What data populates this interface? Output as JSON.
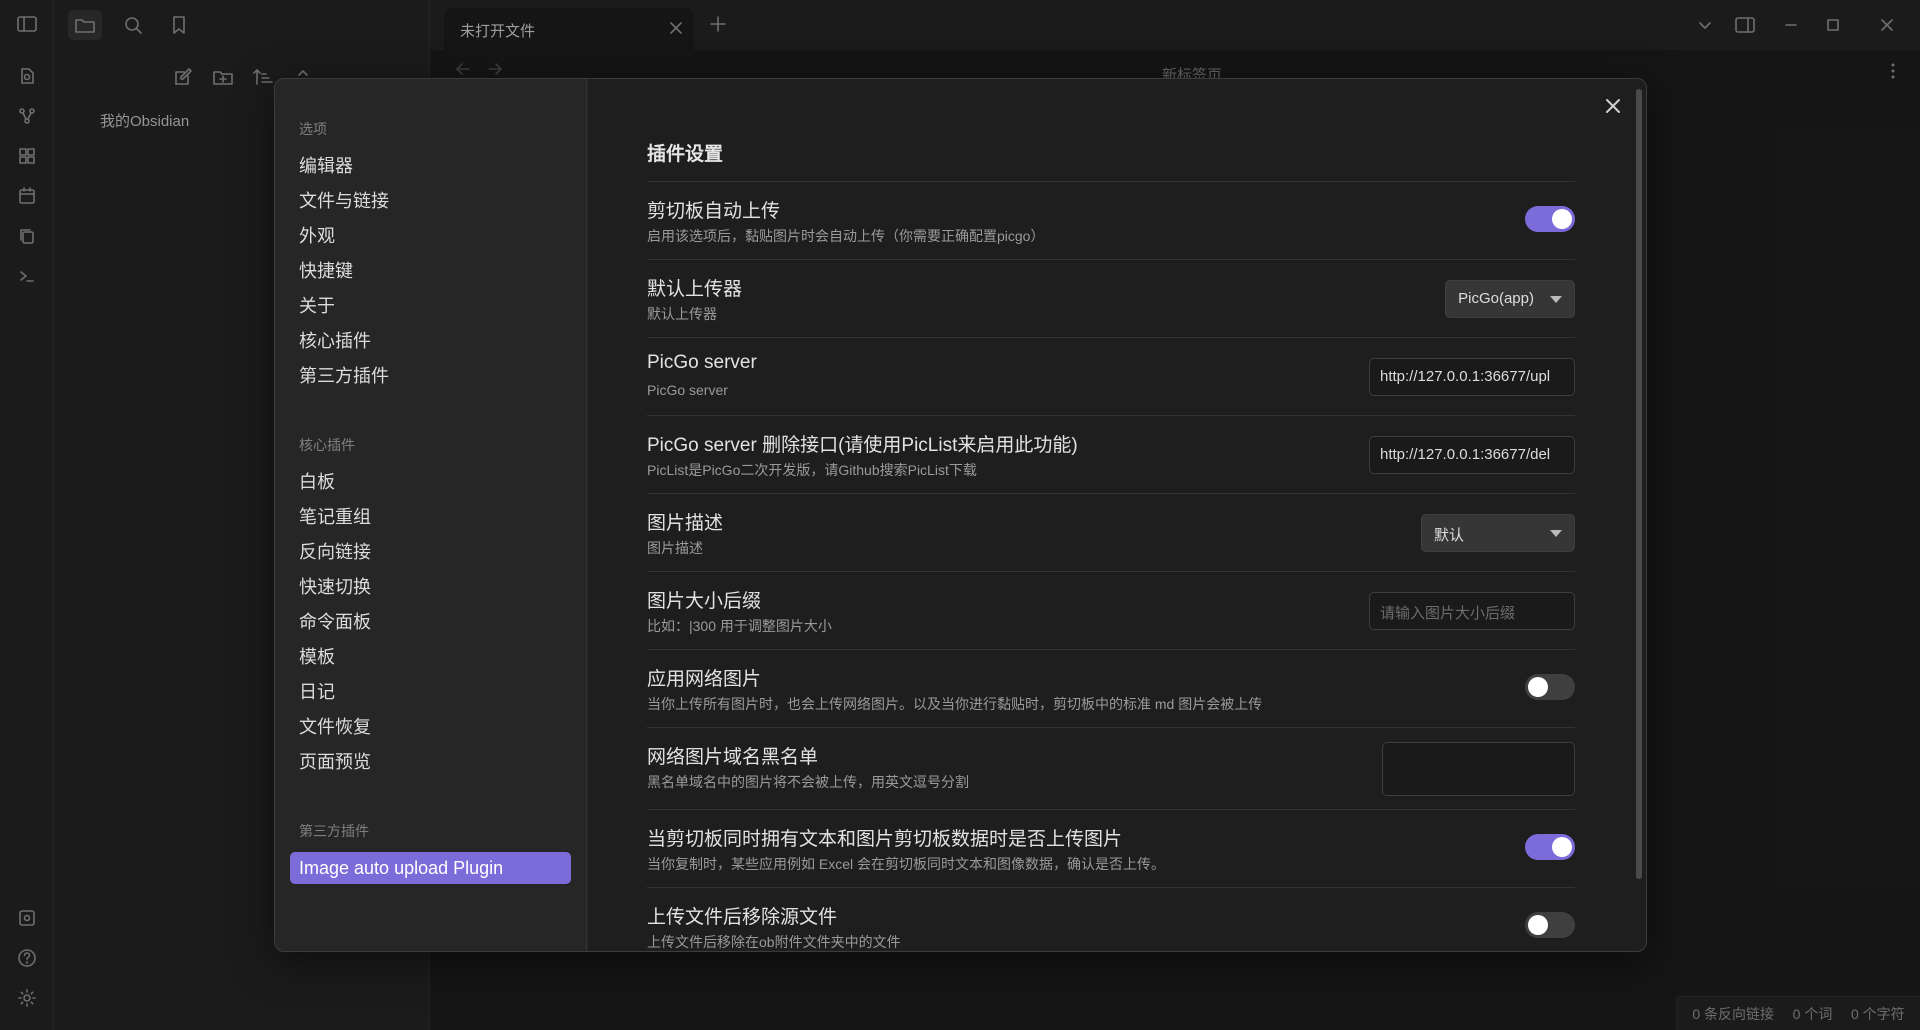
{
  "tabbar": {
    "tab_title": "未打开文件"
  },
  "view": {
    "title": "新标签页"
  },
  "sidebar": {
    "vault_name": "我的Obsidian"
  },
  "status": {
    "backlinks": "0 条反向链接",
    "words": "0 个词",
    "chars": "0 个字符"
  },
  "modal": {
    "nav": {
      "options_header": "选项",
      "options": [
        "编辑器",
        "文件与链接",
        "外观",
        "快捷键",
        "关于",
        "核心插件",
        "第三方插件"
      ],
      "core_header": "核心插件",
      "core": [
        "白板",
        "笔记重组",
        "反向链接",
        "快速切换",
        "命令面板",
        "模板",
        "日记",
        "文件恢复",
        "页面预览"
      ],
      "community_header": "第三方插件",
      "active_item": "Image auto upload Plugin"
    },
    "section_title": "插件设置",
    "settings": [
      {
        "name": "剪切板自动上传",
        "desc": "启用该选项后，黏贴图片时会自动上传（你需要正确配置picgo）",
        "toggle": true
      },
      {
        "name": "默认上传器",
        "desc": "默认上传器",
        "select": "PicGo(app)"
      },
      {
        "name": "PicGo server",
        "desc": "PicGo server",
        "value": "http://127.0.0.1:36677/upl"
      },
      {
        "name": "PicGo server 删除接口(请使用PicList来启用此功能)",
        "desc": "PicList是PicGo二次开发版，请Github搜索PicList下载",
        "value": "http://127.0.0.1:36677/del"
      },
      {
        "name": "图片描述",
        "desc": "图片描述",
        "select": "默认"
      },
      {
        "name": "图片大小后缀",
        "desc": "比如：|300 用于调整图片大小",
        "placeholder": "请输入图片大小后缀"
      },
      {
        "name": "应用网络图片",
        "desc": "当你上传所有图片时，也会上传网络图片。以及当你进行黏贴时，剪切板中的标准 md 图片会被上传",
        "toggle": false
      },
      {
        "name": "网络图片域名黑名单",
        "desc": "黑名单域名中的图片将不会被上传，用英文逗号分割",
        "textarea": ""
      },
      {
        "name": "当剪切板同时拥有文本和图片剪切板数据时是否上传图片",
        "desc": "当你复制时，某些应用例如 Excel 会在剪切板同时文本和图像数据，确认是否上传。",
        "toggle": true
      },
      {
        "name": "上传文件后移除源文件",
        "desc": "上传文件后移除在ob附件文件夹中的文件",
        "toggle": false
      }
    ]
  }
}
